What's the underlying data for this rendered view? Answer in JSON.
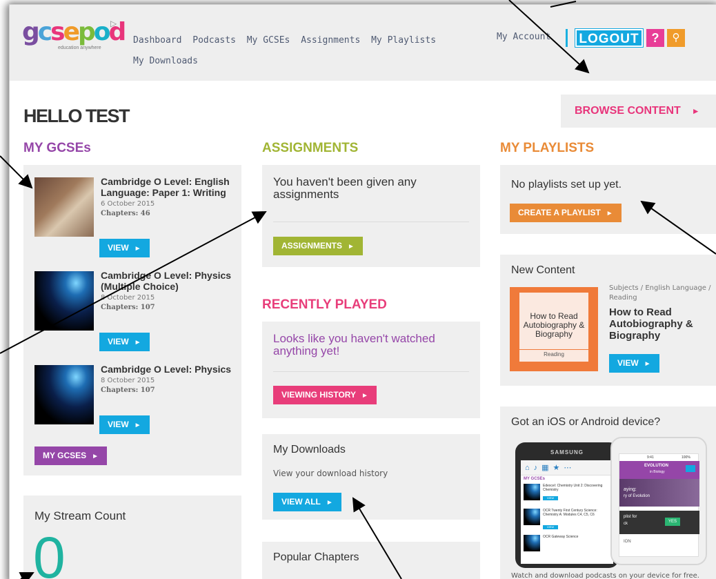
{
  "header": {
    "logo_text": [
      "g",
      "c",
      "s",
      "e",
      "p",
      "o",
      "d",
      ""
    ],
    "logo_tagline": "education anywhere",
    "nav": [
      "Dashboard",
      "Podcasts",
      "My GCSEs",
      "Assignments",
      "My Playlists",
      "My Downloads"
    ],
    "my_account": "My Account",
    "logout": "LOGOUT",
    "help": "?",
    "search_icon": "search-icon"
  },
  "greeting": "HELLO TEST",
  "browse": {
    "label": "BROWSE CONTENT",
    "arrow": "►"
  },
  "gcses": {
    "title": "MY GCSEs",
    "items": [
      {
        "title": "Cambridge O Level: English Language: Paper 1: Writing",
        "date": "6 October 2015",
        "chapters": "Chapters: 46",
        "button": "VIEW",
        "thumb": "writing"
      },
      {
        "title": "Cambridge O Level: Physics (Multiple Choice)",
        "date": "8 October 2015",
        "chapters": "Chapters: 107",
        "button": "VIEW",
        "thumb": "earth"
      },
      {
        "title": "Cambridge O Level: Physics",
        "date": "8 October 2015",
        "chapters": "Chapters: 107",
        "button": "VIEW",
        "thumb": "earth"
      }
    ],
    "button": "MY GCSES"
  },
  "stream": {
    "title": "My Stream Count",
    "count": "0"
  },
  "assignments": {
    "title": "ASSIGNMENTS",
    "message": "You haven't been given any assignments",
    "button": "ASSIGNMENTS"
  },
  "recent": {
    "title": "RECENTLY PLAYED",
    "message": "Looks like you haven't watched anything yet!",
    "button": "VIEWING HISTORY"
  },
  "downloads": {
    "title": "My Downloads",
    "sub": "View your download history",
    "button": "VIEW ALL"
  },
  "popular": {
    "title": "Popular Chapters"
  },
  "playlists": {
    "title": "MY PLAYLISTS",
    "message": "No playlists set up yet.",
    "button": "CREATE A PLAYLIST"
  },
  "new_content": {
    "title": "New Content",
    "book_title": "How to Read Autobiography & Biography",
    "book_foot": "Reading",
    "crumb": "Subjects / English Language / Reading",
    "item_title": "How to Read Autobiography & Biography",
    "button": "VIEW"
  },
  "app": {
    "title": "Got an iOS or Android device?",
    "caption": "Watch and download podcasts on your device for free.",
    "phone_brand": "SAMSUNG",
    "phone_section": "MY GCSEs",
    "iphone_time": "9:41",
    "iphone_batt": "100%",
    "iphone_heading": "EVOLUTION",
    "iphone_sub": "in Biology",
    "iphone_text1": "aying:",
    "iphone_text2": "ry of Evolution",
    "iphone_text3": "plist for",
    "iphone_text4": "ck",
    "iphone_yes": "YES",
    "iphone_ion": "ION",
    "phone_item1": "Edexcel: Chemistry Unit 2: Discovering Chemistry",
    "phone_item2": "OCR Twenty First Century Science: Chemistry A: Modules C4, C5, C6",
    "phone_item3": "OCR Gateway Science",
    "phone_view": "VIEW"
  },
  "colors": {
    "purple": "#9546a8",
    "olive": "#a1b534",
    "pink": "#e83d7a",
    "orange": "#e98b37",
    "blue": "#13a8e0"
  }
}
